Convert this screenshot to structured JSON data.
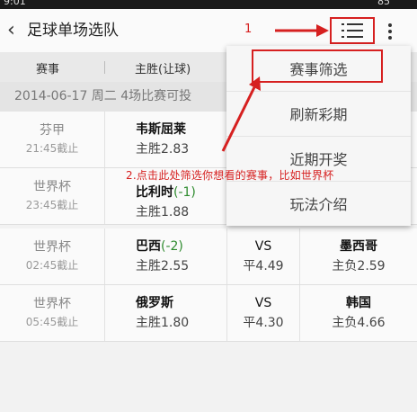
{
  "status_bar": {
    "time": "9:01",
    "battery": "85"
  },
  "header": {
    "back_icon": "chevron-left-icon",
    "title": "足球单场选队",
    "menu_icon": "list-icon",
    "more_icon": "more-vert-icon"
  },
  "columns": {
    "event": "赛事",
    "home": "主胜(让球)"
  },
  "date_row": "2014-06-17 周二  4场比赛可投",
  "matches": [
    {
      "league": "芬甲",
      "deadline": "21:45截止",
      "home_team": "韦斯屈莱",
      "handicap": "",
      "home_odds": "主胜2.83",
      "vs": "",
      "draw_odds": "",
      "away_team": "",
      "away_odds": ""
    },
    {
      "league": "世界杯",
      "deadline": "23:45截止",
      "home_team": "比利时",
      "handicap": "(-1)",
      "home_odds": "主胜1.88",
      "vs": "",
      "draw_odds": "",
      "away_team": "",
      "away_odds": ""
    },
    {
      "league": "世界杯",
      "deadline": "02:45截止",
      "home_team": "巴西",
      "handicap": "(-2)",
      "home_odds": "主胜2.55",
      "vs": "VS",
      "draw_odds": "平4.49",
      "away_team": "墨西哥",
      "away_odds": "主负2.59"
    },
    {
      "league": "世界杯",
      "deadline": "05:45截止",
      "home_team": "俄罗斯",
      "handicap": "",
      "home_odds": "主胜1.80",
      "vs": "VS",
      "draw_odds": "平4.30",
      "away_team": "韩国",
      "away_odds": "主负4.66"
    }
  ],
  "menu": {
    "items": [
      "赛事筛选",
      "刷新彩期",
      "近期开奖",
      "玩法介绍"
    ]
  },
  "annotations": {
    "step1": "1",
    "step2": "2.点击此处筛选你想看的赛事，比如世界杯"
  },
  "colors": {
    "annotation_red": "#d62020",
    "handicap_green": "#2e8b2e"
  }
}
